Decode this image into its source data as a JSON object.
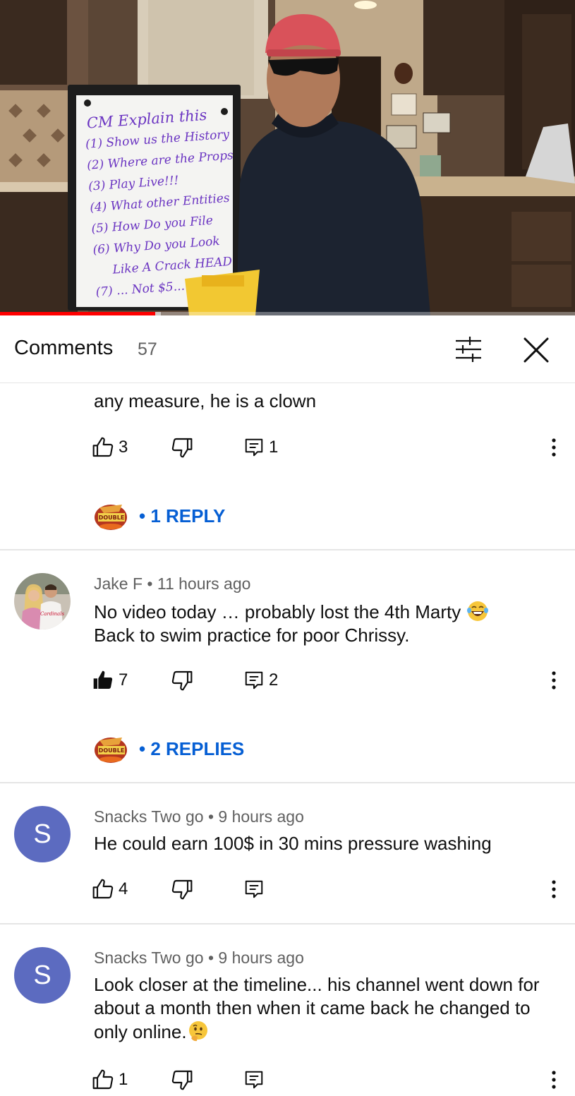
{
  "video": {
    "board": {
      "title": "CM Explain this",
      "lines": [
        "(1) Show us the History",
        "(2) Where are the Props",
        "(3) Play Live!!!",
        "(4) What other Entities",
        "(5) How Do you File",
        "(6) Why Do you Look",
        "Like A Crack HEAD",
        "(7) ... Not $5..."
      ]
    },
    "progress_fraction": 0.27,
    "buffer_fraction": 0.28
  },
  "header": {
    "title": "Comments",
    "count": "57",
    "filter_icon": "sliders-icon",
    "close_icon": "close-icon"
  },
  "comments": [
    {
      "author": "",
      "time": "",
      "text": "any measure, he is a clown",
      "likes": "3",
      "liked": false,
      "replies_count": "1",
      "reply_link": "• 1 REPLY"
    },
    {
      "author": "Jake F",
      "time": "11 hours ago",
      "meta": "Jake F • 11 hours ago",
      "text": "No video today … probably lost the 4th Marty",
      "text2": "Back to swim practice for poor Chrissy.",
      "emoji": "laughing-tears-emoji",
      "likes": "7",
      "liked": true,
      "replies_count": "2",
      "reply_link": "• 2 REPLIES"
    },
    {
      "author": "Snacks Two go",
      "meta": "Snacks Two go • 9 hours ago",
      "avatar_letter": "S",
      "text": "He could earn 100$ in 30 mins pressure washing",
      "likes": "4",
      "liked": false,
      "replies_count": ""
    },
    {
      "author": "Snacks Two go",
      "meta": "Snacks Two go • 9 hours ago",
      "avatar_letter": "S",
      "text": "Look closer at the timeline... his channel went down for about a month then when it came back he changed to only online.",
      "emoji": "thinking-face-emoji",
      "likes": "1",
      "liked": false,
      "replies_count": ""
    }
  ],
  "colors": {
    "link_blue": "#065fd4",
    "avatar_purple": "#5c6bc0",
    "progress_red": "#ff0000",
    "muted_text": "#606060"
  }
}
